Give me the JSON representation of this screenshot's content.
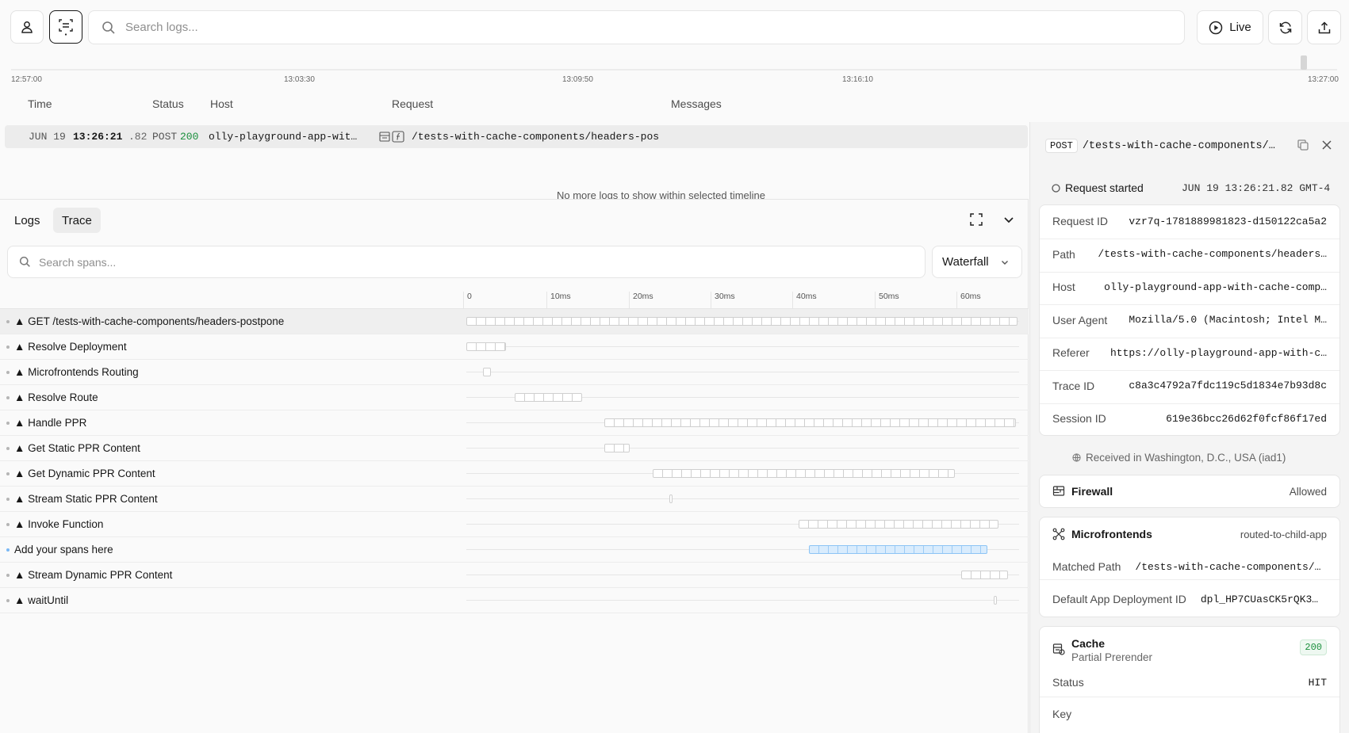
{
  "toolbar": {
    "search_placeholder": "Search logs...",
    "live_label": "Live"
  },
  "timeline": {
    "labels": [
      "12:57:00",
      "13:03:30",
      "13:09:50",
      "13:16:10",
      "13:27:00"
    ]
  },
  "table": {
    "columns": [
      "Time",
      "Status",
      "Host",
      "Request",
      "Messages"
    ],
    "row": {
      "date": "JUN 19",
      "time": "13:26:21",
      "ms": ".82",
      "method": "POST",
      "status": "200",
      "host": "olly-playground-app-wit…",
      "path": "/tests-with-cache-components/headers-pos"
    },
    "no_more": "No more logs to show within selected timeline"
  },
  "pane": {
    "tabs": [
      "Logs",
      "Trace"
    ],
    "span_search_placeholder": "Search spans...",
    "view_select": "Waterfall",
    "ticks": [
      "0",
      "10ms",
      "20ms",
      "30ms",
      "40ms",
      "50ms",
      "60ms"
    ],
    "spans": [
      {
        "name": "▲ GET /tests-with-cache-components/headers-postpone",
        "start_ms": 0.0,
        "end_ms": 67.5
      },
      {
        "name": "▲ Resolve Deployment",
        "start_ms": 0.0,
        "end_ms": 4.9
      },
      {
        "name": "▲ Microfrontends Routing",
        "start_ms": 2.0,
        "end_ms": 3.0
      },
      {
        "name": "▲ Resolve Route",
        "start_ms": 5.9,
        "end_ms": 14.2
      },
      {
        "name": "▲ Handle PPR",
        "start_ms": 16.9,
        "end_ms": 67.3
      },
      {
        "name": "▲ Get Static PPR Content",
        "start_ms": 16.9,
        "end_ms": 20.0
      },
      {
        "name": "▲ Get Dynamic PPR Content",
        "start_ms": 22.8,
        "end_ms": 59.8
      },
      {
        "name": "▲ Stream Static PPR Content",
        "start_ms": 24.9,
        "end_ms": 25.1
      },
      {
        "name": "▲ Invoke Function",
        "start_ms": 40.7,
        "end_ms": 65.1
      },
      {
        "name": "Add your spans here",
        "start_ms": 41.9,
        "end_ms": 63.8
      },
      {
        "name": "▲ Stream Dynamic PPR Content",
        "start_ms": 60.6,
        "end_ms": 66.3
      },
      {
        "name": "▲ waitUntil",
        "start_ms": 64.6,
        "end_ms": 64.8
      }
    ]
  },
  "detail": {
    "method": "POST",
    "path": "/tests-with-cache-components/…",
    "request_started_label": "Request started",
    "request_started_time": "JUN 19 13:26:21.82 GMT-4",
    "fields": [
      {
        "key": "Request ID",
        "value": "vzr7q-1781889981823-d150122ca5a2"
      },
      {
        "key": "Path",
        "value": "/tests-with-cache-components/headers…"
      },
      {
        "key": "Host",
        "value": "olly-playground-app-with-cache-comp…"
      },
      {
        "key": "User Agent",
        "value": "Mozilla/5.0 (Macintosh; Intel M…"
      },
      {
        "key": "Referer",
        "value": "https://olly-playground-app-with-c…"
      },
      {
        "key": "Trace ID",
        "value": "c8a3c4792a7fdc119c5d1834e7b93d8c"
      },
      {
        "key": "Session ID",
        "value": "619e36bcc26d62f0fcf86f17ed"
      }
    ],
    "received": "Received in Washington, D.C., USA (iad1)",
    "firewall": {
      "title": "Firewall",
      "status": "Allowed"
    },
    "microfrontends": {
      "title": "Microfrontends",
      "status": "routed-to-child-app",
      "matched_path_key": "Matched Path",
      "matched_path_value": "/tests-with-cache-components/…",
      "default_app_key": "Default App Deployment ID",
      "default_app_value": "dpl_HP7CUasCK5rQK3…"
    },
    "cache": {
      "title": "Cache",
      "subtitle": "Partial Prerender",
      "badge": "200",
      "status_key": "Status",
      "status_value": "HIT",
      "key_label": "Key"
    }
  }
}
